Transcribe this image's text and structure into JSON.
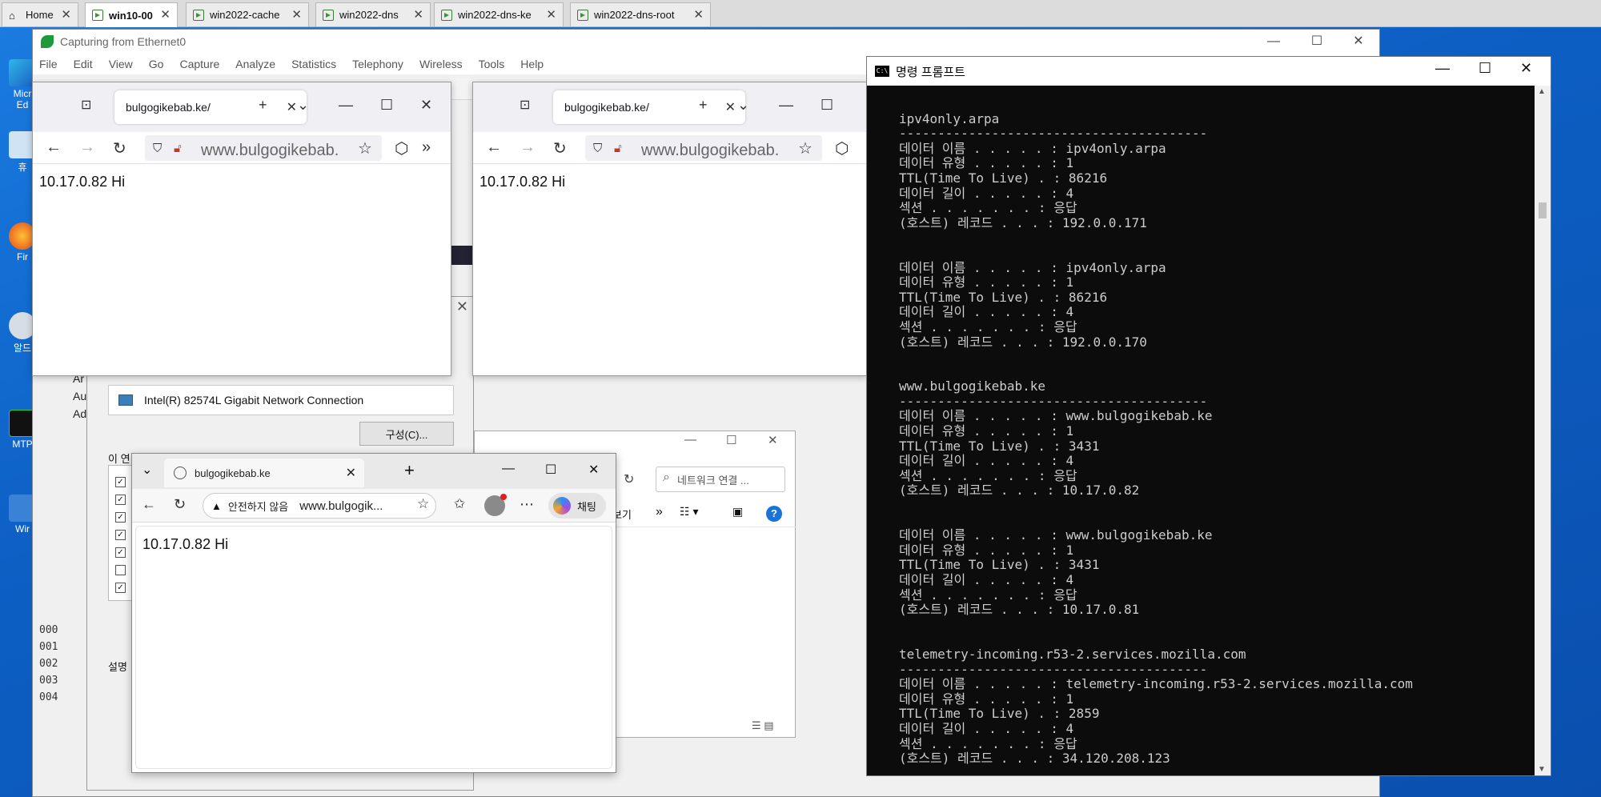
{
  "vm_tabs": [
    {
      "label": "Home"
    },
    {
      "label": "win10-00"
    },
    {
      "label": "win2022-cache"
    },
    {
      "label": "win2022-dns"
    },
    {
      "label": "win2022-dns-ke"
    },
    {
      "label": "win2022-dns-root"
    }
  ],
  "desktop_icons": [
    "Micr Ed",
    "휴",
    "Fir",
    "알드",
    "MTP",
    "Wir"
  ],
  "wireshark": {
    "title": "Capturing from Ethernet0",
    "menu": [
      "File",
      "Edit",
      "View",
      "Go",
      "Capture",
      "Analyze",
      "Statistics",
      "Telephony",
      "Wireless",
      "Tools",
      "Help"
    ],
    "hex_rows": [
      "000",
      "001",
      "002",
      "003",
      "004"
    ]
  },
  "net_props": {
    "adapter": "Intel(R) 82574L Gigabit Network Connection",
    "configure_button": "구성(C)...",
    "list_label": "이 연",
    "side_labels": [
      "Ar",
      "Au",
      "Ad"
    ],
    "desc_label": "설명"
  },
  "explorer": {
    "search_placeholder": "네트워크 연결 ...",
    "view_label": "보기"
  },
  "firefox_left": {
    "tab_title": "bulgogikebab.ke/",
    "url": "www.bulgogikebab.",
    "content": "10.17.0.82 Hi"
  },
  "firefox_right": {
    "tab_title": "bulgogikebab.ke/",
    "url": "www.bulgogikebab.",
    "content": "10.17.0.82 Hi"
  },
  "edge": {
    "tab_title": "bulgogikebab.ke",
    "insecure_label": "안전하지 않음",
    "url": "www.bulgogik...",
    "chat_label": "채팅",
    "content": "10.17.0.82 Hi"
  },
  "cmd": {
    "title": "명령 프롬프트",
    "lines": [
      "",
      "ipv4only.arpa",
      "----------------------------------------",
      "데이터 이름 . . . . . : ipv4only.arpa",
      "데이터 유형 . . . . . : 1",
      "TTL(Time To Live) . : 86216",
      "데이터 길이 . . . . . : 4",
      "섹션 . . . . . . . : 응답",
      "(호스트) 레코드 . . . : 192.0.0.171",
      "",
      "",
      "데이터 이름 . . . . . : ipv4only.arpa",
      "데이터 유형 . . . . . : 1",
      "TTL(Time To Live) . : 86216",
      "데이터 길이 . . . . . : 4",
      "섹션 . . . . . . . : 응답",
      "(호스트) 레코드 . . . : 192.0.0.170",
      "",
      "",
      "www.bulgogikebab.ke",
      "----------------------------------------",
      "데이터 이름 . . . . . : www.bulgogikebab.ke",
      "데이터 유형 . . . . . : 1",
      "TTL(Time To Live) . : 3431",
      "데이터 길이 . . . . . : 4",
      "섹션 . . . . . . . : 응답",
      "(호스트) 레코드 . . . : 10.17.0.82",
      "",
      "",
      "데이터 이름 . . . . . : www.bulgogikebab.ke",
      "데이터 유형 . . . . . : 1",
      "TTL(Time To Live) . : 3431",
      "데이터 길이 . . . . . : 4",
      "섹션 . . . . . . . : 응답",
      "(호스트) 레코드 . . . : 10.17.0.81",
      "",
      "",
      "telemetry-incoming.r53-2.services.mozilla.com",
      "----------------------------------------",
      "데이터 이름 . . . . . : telemetry-incoming.r53-2.services.mozilla.com",
      "데이터 유형 . . . . . : 1",
      "TTL(Time To Live) . : 2859",
      "데이터 길이 . . . . . : 4",
      "섹션 . . . . . . . : 응답",
      "(호스트) 레코드 . . . : 34.120.208.123"
    ]
  }
}
